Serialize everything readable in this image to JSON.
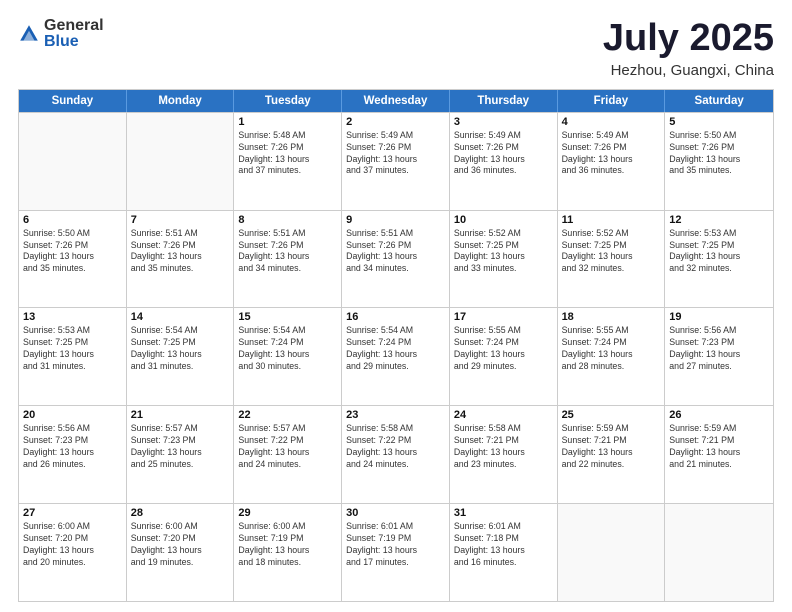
{
  "header": {
    "logo_general": "General",
    "logo_blue": "Blue",
    "month_title": "July 2025",
    "location": "Hezhou, Guangxi, China"
  },
  "weekdays": [
    "Sunday",
    "Monday",
    "Tuesday",
    "Wednesday",
    "Thursday",
    "Friday",
    "Saturday"
  ],
  "rows": [
    [
      {
        "day": "",
        "empty": true
      },
      {
        "day": "",
        "empty": true
      },
      {
        "day": "1",
        "lines": [
          "Sunrise: 5:48 AM",
          "Sunset: 7:26 PM",
          "Daylight: 13 hours",
          "and 37 minutes."
        ]
      },
      {
        "day": "2",
        "lines": [
          "Sunrise: 5:49 AM",
          "Sunset: 7:26 PM",
          "Daylight: 13 hours",
          "and 37 minutes."
        ]
      },
      {
        "day": "3",
        "lines": [
          "Sunrise: 5:49 AM",
          "Sunset: 7:26 PM",
          "Daylight: 13 hours",
          "and 36 minutes."
        ]
      },
      {
        "day": "4",
        "lines": [
          "Sunrise: 5:49 AM",
          "Sunset: 7:26 PM",
          "Daylight: 13 hours",
          "and 36 minutes."
        ]
      },
      {
        "day": "5",
        "lines": [
          "Sunrise: 5:50 AM",
          "Sunset: 7:26 PM",
          "Daylight: 13 hours",
          "and 35 minutes."
        ]
      }
    ],
    [
      {
        "day": "6",
        "lines": [
          "Sunrise: 5:50 AM",
          "Sunset: 7:26 PM",
          "Daylight: 13 hours",
          "and 35 minutes."
        ]
      },
      {
        "day": "7",
        "lines": [
          "Sunrise: 5:51 AM",
          "Sunset: 7:26 PM",
          "Daylight: 13 hours",
          "and 35 minutes."
        ]
      },
      {
        "day": "8",
        "lines": [
          "Sunrise: 5:51 AM",
          "Sunset: 7:26 PM",
          "Daylight: 13 hours",
          "and 34 minutes."
        ]
      },
      {
        "day": "9",
        "lines": [
          "Sunrise: 5:51 AM",
          "Sunset: 7:26 PM",
          "Daylight: 13 hours",
          "and 34 minutes."
        ]
      },
      {
        "day": "10",
        "lines": [
          "Sunrise: 5:52 AM",
          "Sunset: 7:25 PM",
          "Daylight: 13 hours",
          "and 33 minutes."
        ]
      },
      {
        "day": "11",
        "lines": [
          "Sunrise: 5:52 AM",
          "Sunset: 7:25 PM",
          "Daylight: 13 hours",
          "and 32 minutes."
        ]
      },
      {
        "day": "12",
        "lines": [
          "Sunrise: 5:53 AM",
          "Sunset: 7:25 PM",
          "Daylight: 13 hours",
          "and 32 minutes."
        ]
      }
    ],
    [
      {
        "day": "13",
        "lines": [
          "Sunrise: 5:53 AM",
          "Sunset: 7:25 PM",
          "Daylight: 13 hours",
          "and 31 minutes."
        ]
      },
      {
        "day": "14",
        "lines": [
          "Sunrise: 5:54 AM",
          "Sunset: 7:25 PM",
          "Daylight: 13 hours",
          "and 31 minutes."
        ]
      },
      {
        "day": "15",
        "lines": [
          "Sunrise: 5:54 AM",
          "Sunset: 7:24 PM",
          "Daylight: 13 hours",
          "and 30 minutes."
        ]
      },
      {
        "day": "16",
        "lines": [
          "Sunrise: 5:54 AM",
          "Sunset: 7:24 PM",
          "Daylight: 13 hours",
          "and 29 minutes."
        ]
      },
      {
        "day": "17",
        "lines": [
          "Sunrise: 5:55 AM",
          "Sunset: 7:24 PM",
          "Daylight: 13 hours",
          "and 29 minutes."
        ]
      },
      {
        "day": "18",
        "lines": [
          "Sunrise: 5:55 AM",
          "Sunset: 7:24 PM",
          "Daylight: 13 hours",
          "and 28 minutes."
        ]
      },
      {
        "day": "19",
        "lines": [
          "Sunrise: 5:56 AM",
          "Sunset: 7:23 PM",
          "Daylight: 13 hours",
          "and 27 minutes."
        ]
      }
    ],
    [
      {
        "day": "20",
        "lines": [
          "Sunrise: 5:56 AM",
          "Sunset: 7:23 PM",
          "Daylight: 13 hours",
          "and 26 minutes."
        ]
      },
      {
        "day": "21",
        "lines": [
          "Sunrise: 5:57 AM",
          "Sunset: 7:23 PM",
          "Daylight: 13 hours",
          "and 25 minutes."
        ]
      },
      {
        "day": "22",
        "lines": [
          "Sunrise: 5:57 AM",
          "Sunset: 7:22 PM",
          "Daylight: 13 hours",
          "and 24 minutes."
        ]
      },
      {
        "day": "23",
        "lines": [
          "Sunrise: 5:58 AM",
          "Sunset: 7:22 PM",
          "Daylight: 13 hours",
          "and 24 minutes."
        ]
      },
      {
        "day": "24",
        "lines": [
          "Sunrise: 5:58 AM",
          "Sunset: 7:21 PM",
          "Daylight: 13 hours",
          "and 23 minutes."
        ]
      },
      {
        "day": "25",
        "lines": [
          "Sunrise: 5:59 AM",
          "Sunset: 7:21 PM",
          "Daylight: 13 hours",
          "and 22 minutes."
        ]
      },
      {
        "day": "26",
        "lines": [
          "Sunrise: 5:59 AM",
          "Sunset: 7:21 PM",
          "Daylight: 13 hours",
          "and 21 minutes."
        ]
      }
    ],
    [
      {
        "day": "27",
        "lines": [
          "Sunrise: 6:00 AM",
          "Sunset: 7:20 PM",
          "Daylight: 13 hours",
          "and 20 minutes."
        ]
      },
      {
        "day": "28",
        "lines": [
          "Sunrise: 6:00 AM",
          "Sunset: 7:20 PM",
          "Daylight: 13 hours",
          "and 19 minutes."
        ]
      },
      {
        "day": "29",
        "lines": [
          "Sunrise: 6:00 AM",
          "Sunset: 7:19 PM",
          "Daylight: 13 hours",
          "and 18 minutes."
        ]
      },
      {
        "day": "30",
        "lines": [
          "Sunrise: 6:01 AM",
          "Sunset: 7:19 PM",
          "Daylight: 13 hours",
          "and 17 minutes."
        ]
      },
      {
        "day": "31",
        "lines": [
          "Sunrise: 6:01 AM",
          "Sunset: 7:18 PM",
          "Daylight: 13 hours",
          "and 16 minutes."
        ]
      },
      {
        "day": "",
        "empty": true
      },
      {
        "day": "",
        "empty": true
      }
    ]
  ]
}
